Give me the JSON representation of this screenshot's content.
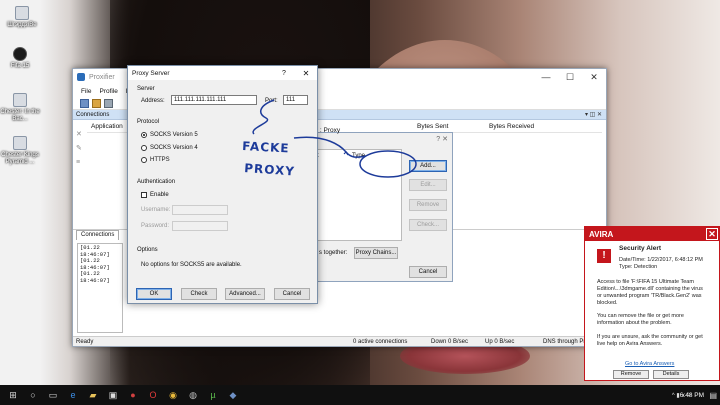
{
  "desktop": {
    "icons": [
      {
        "label": "ШгэрдзıВе",
        "icon": "file-icon"
      },
      {
        "label": "Fifa 15",
        "icon": "fifa-icon"
      },
      {
        "label": "Chester: In the Bac...",
        "icon": "file-icon"
      },
      {
        "label": "Chester Kings Pyramid ...",
        "icon": "file-icon"
      }
    ]
  },
  "proxifier": {
    "title": "Proxifier",
    "menu": [
      "File",
      "Profile",
      "L"
    ],
    "connections_label": "Connections",
    "col_application": "Application",
    "col_bytes_sent": "Bytes Sent",
    "col_bytes_received": "Bytes Received",
    "connections_tab": "Connections",
    "log_lines": [
      "[01.22 18:46:07]",
      "[01.22 18:46:07]",
      "[01.22 18:46:07]"
    ],
    "status": {
      "ready": "Ready",
      "active": "0 active connections",
      "down": "Down 0 B/sec",
      "up": "Up 0 B/sec",
      "dns": "DNS through Proxy"
    }
  },
  "proxy_servers": {
    "header_fragment": "le : Proxy",
    "col_type_frag": "t",
    "col_type": "Type",
    "buttons": {
      "add": "Add...",
      "edit": "Edit...",
      "remove": "Remove",
      "check": "Check...",
      "cancel": "Cancel"
    },
    "chain_label": "s together:",
    "chain_button": "Proxy Chains..."
  },
  "proxy_dialog": {
    "title": "Proxy Server",
    "help": "?",
    "close": "✕",
    "server_group": "Server",
    "address_label": "Address:",
    "address_value": "111.111.111.111.111",
    "port_label": "Port:",
    "port_value": "111",
    "protocol_group": "Protocol",
    "protocols": [
      "SOCKS Version 5",
      "SOCKS Version 4",
      "HTTPS"
    ],
    "selected_protocol": "SOCKS Version 5",
    "auth_group": "Authentication",
    "enable_label": "Enable",
    "username_label": "Username:",
    "password_label": "Password:",
    "options_group": "Options",
    "options_text": "No options for SOCKS5 are available.",
    "buttons": {
      "ok": "OK",
      "check": "Check",
      "advanced": "Advanced...",
      "cancel": "Cancel"
    }
  },
  "annotation": {
    "line1": "FACKE",
    "line2": "PROXY",
    "color": "#1d3b9a"
  },
  "avira": {
    "brand": "AVIRA",
    "heading": "Security Alert",
    "date": "Date/Time: 1/22/2017, 6:48:12 PM",
    "type": "Type: Detection",
    "body": [
      "Access to file 'F:\\FIFA 15 Ultimate Team",
      "Edition\\...\\3dmgame.dll' containing the virus",
      "or unwanted program 'TR/Black.Gen2' was",
      "blocked."
    ],
    "body2": [
      "You can remove the file or get more",
      "information about the problem."
    ],
    "body3": [
      "If you are unsure, ask the community or get",
      "live help on Avira Answers."
    ],
    "link": "Go to Avira Answers",
    "remove": "Remove",
    "details": "Details",
    "accent": "#c4161c"
  },
  "taskbar": {
    "clock": "6:48 PM",
    "icons": [
      "windows-icon",
      "search-icon",
      "task-view-icon",
      "edge-icon",
      "folder-icon",
      "store-icon",
      "app-icon",
      "opera-icon",
      "chrome-icon",
      "app-icon",
      "utorrent-icon",
      "proxifier-icon"
    ]
  }
}
